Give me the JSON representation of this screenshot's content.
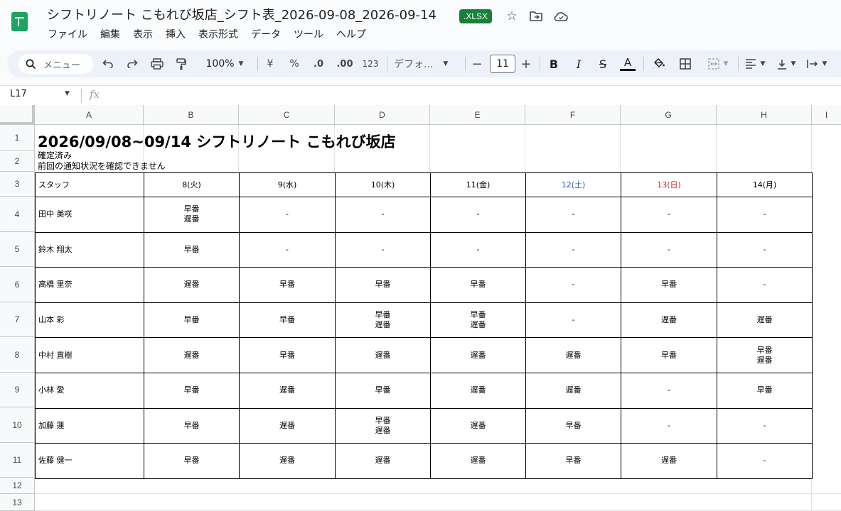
{
  "document": {
    "title": "シフトリノート こもれび坂店_シフト表_2026-09-08_2026-09-14",
    "extension": ".XLSX"
  },
  "title_icons": {
    "star": "☆",
    "move": "⇥",
    "cloud": "☁"
  },
  "menu": [
    "ファイル",
    "編集",
    "表示",
    "挿入",
    "表示形式",
    "データ",
    "ツール",
    "ヘルプ"
  ],
  "toolbar": {
    "search_label": "メニュー",
    "zoom": "100%",
    "currency": "¥",
    "percent": "%",
    "decrease_decimal": ".0",
    "increase_decimal": ".00",
    "number_format": "123",
    "font": "デフォ...",
    "font_size": "11",
    "minus": "−",
    "plus": "+",
    "bold": "B",
    "italic": "I",
    "strike": "S",
    "text_color": "A"
  },
  "formula_bar": {
    "cell_ref": "L17",
    "fx": "fx"
  },
  "columns": [
    "A",
    "B",
    "C",
    "D",
    "E",
    "F",
    "G",
    "H",
    "I"
  ],
  "rows": [
    "1",
    "2",
    "3",
    "4",
    "5",
    "6",
    "7",
    "8",
    "9",
    "10",
    "11",
    "12",
    "13"
  ],
  "sheet": {
    "title": "2026/09/08~09/14 シフトリノート こもれび坂店",
    "status": "確定済み",
    "notice": "前回の通知状況を確認できません",
    "header": {
      "staff": "スタッフ",
      "days": [
        "8(火)",
        "9(水)",
        "10(木)",
        "11(金)",
        "12(土)",
        "13(日)",
        "14(月)"
      ]
    },
    "day_colors": [
      "#000000",
      "#000000",
      "#000000",
      "#000000",
      "#1a5fb4",
      "#c5221f",
      "#000000"
    ],
    "staff": [
      {
        "name": "田中 美咲",
        "shifts": [
          [
            "早番",
            "遅番"
          ],
          [
            "-"
          ],
          [
            "-"
          ],
          [
            "-"
          ],
          [
            "-"
          ],
          [
            "-"
          ],
          [
            "-"
          ]
        ]
      },
      {
        "name": "鈴木 翔太",
        "shifts": [
          [
            "早番"
          ],
          [
            "-"
          ],
          [
            "-"
          ],
          [
            "-"
          ],
          [
            "-"
          ],
          [
            "-"
          ],
          [
            "-"
          ]
        ]
      },
      {
        "name": "高橋 里奈",
        "shifts": [
          [
            "遅番"
          ],
          [
            "早番"
          ],
          [
            "早番"
          ],
          [
            "早番"
          ],
          [
            "-"
          ],
          [
            "早番"
          ],
          [
            "-"
          ]
        ]
      },
      {
        "name": "山本 彩",
        "shifts": [
          [
            "早番"
          ],
          [
            "早番"
          ],
          [
            "早番",
            "遅番"
          ],
          [
            "早番",
            "遅番"
          ],
          [
            "-"
          ],
          [
            "遅番"
          ],
          [
            "遅番"
          ]
        ]
      },
      {
        "name": "中村 直樹",
        "shifts": [
          [
            "遅番"
          ],
          [
            "早番"
          ],
          [
            "遅番"
          ],
          [
            "遅番"
          ],
          [
            "遅番"
          ],
          [
            "早番"
          ],
          [
            "早番",
            "遅番"
          ]
        ]
      },
      {
        "name": "小林 愛",
        "shifts": [
          [
            "早番"
          ],
          [
            "遅番"
          ],
          [
            "早番"
          ],
          [
            "遅番"
          ],
          [
            "遅番"
          ],
          [
            "-"
          ],
          [
            "早番"
          ]
        ]
      },
      {
        "name": "加藤 蓮",
        "shifts": [
          [
            "早番"
          ],
          [
            "遅番"
          ],
          [
            "早番",
            "遅番"
          ],
          [
            "遅番"
          ],
          [
            "早番"
          ],
          [
            "-"
          ],
          [
            "-"
          ]
        ]
      },
      {
        "name": "佐藤 健一",
        "shifts": [
          [
            "早番"
          ],
          [
            "遅番"
          ],
          [
            "遅番"
          ],
          [
            "遅番"
          ],
          [
            "早番"
          ],
          [
            "遅番"
          ],
          [
            "-"
          ]
        ]
      }
    ]
  }
}
